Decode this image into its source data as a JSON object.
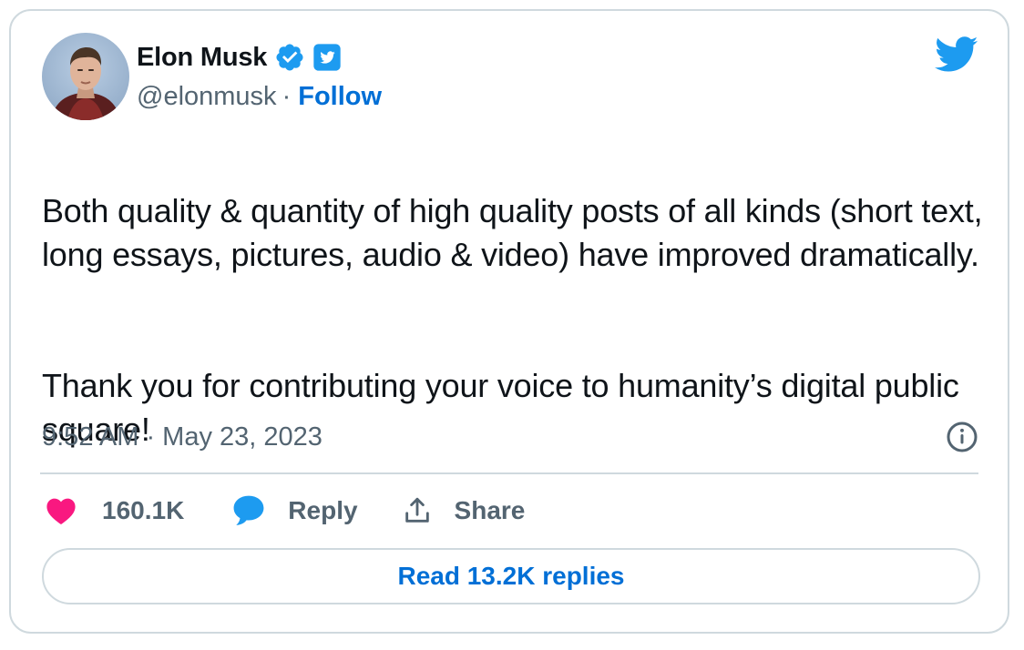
{
  "author": {
    "display_name": "Elon Musk",
    "handle": "@elonmusk",
    "separator": "·",
    "follow_label": "Follow"
  },
  "tweet": {
    "paragraphs": [
      "Both quality & quantity of high quality posts of all kinds (short text, long essays, pictures, audio & video) have improved dramatically.",
      "Thank you for contributing your voice to humanity’s digital public square!"
    ],
    "timestamp": "9:52 AM · May 23, 2023"
  },
  "actions": {
    "like_count": "160.1K",
    "reply_label": "Reply",
    "share_label": "Share"
  },
  "read_replies_label": "Read 13.2K replies",
  "icons": {
    "verified": "verified-badge-icon",
    "twitter_badge": "twitter-square-icon",
    "bird": "twitter-bird-icon",
    "info": "info-icon",
    "like": "heart-icon",
    "reply": "speech-bubble-icon",
    "share": "share-upload-icon"
  },
  "colors": {
    "twitter_blue": "#1d9bf0",
    "link_blue": "#006fd6",
    "like_pink": "#f91880",
    "muted_text": "#536471",
    "border": "#cfd9de"
  }
}
